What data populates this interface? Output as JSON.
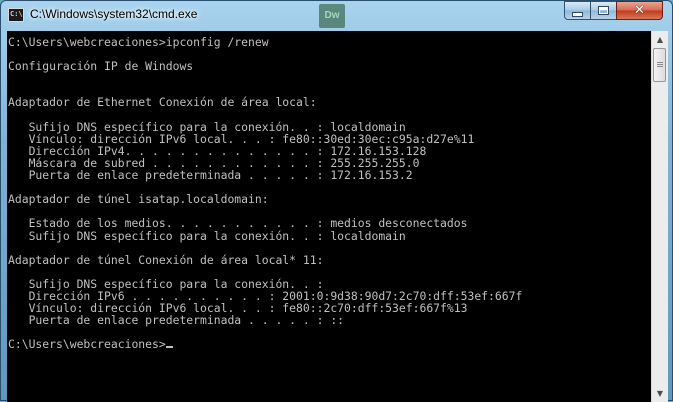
{
  "window": {
    "title": "C:\\Windows\\system32\\cmd.exe",
    "icon_label": "C:\\",
    "background_app_label": "Dw"
  },
  "controls": {
    "minimize": "minimize",
    "maximize": "maximize",
    "close": "✕"
  },
  "console": {
    "lines": [
      "C:\\Users\\webcreaciones>ipconfig /renew",
      "",
      "Configuración IP de Windows",
      "",
      "",
      "Adaptador de Ethernet Conexión de área local:",
      "",
      "   Sufijo DNS específico para la conexión. . : localdomain",
      "   Vínculo: dirección IPv6 local. . . : fe80::30ed:30ec:c95a:d27e%11",
      "   Dirección IPv4. . . . . . . . . . . . . . : 172.16.153.128",
      "   Máscara de subred . . . . . . . . . . . . : 255.255.255.0",
      "   Puerta de enlace predeterminada . . . . . : 172.16.153.2",
      "",
      "Adaptador de túnel isatap.localdomain:",
      "",
      "   Estado de los medios. . . . . . . . . . . : medios desconectados",
      "   Sufijo DNS específico para la conexión. . : localdomain",
      "",
      "Adaptador de túnel Conexión de área local* 11:",
      "",
      "   Sufijo DNS específico para la conexión. . :",
      "   Dirección IPv6 . . . . . . . . . . : 2001:0:9d38:90d7:2c70:dff:53ef:667f",
      "   Vínculo: dirección IPv6 local. . . : fe80::2c70:dff:53ef:667f%13",
      "   Puerta de enlace predeterminada . . . . . : ::",
      "",
      "C:\\Users\\webcreaciones>"
    ]
  },
  "colors": {
    "console_bg": "#000000",
    "console_fg": "#c0c0c0",
    "close_red": "#c2391b"
  }
}
